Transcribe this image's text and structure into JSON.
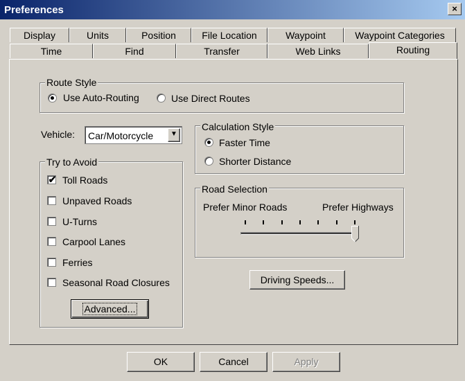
{
  "window": {
    "title": "Preferences",
    "close_glyph": "×"
  },
  "tabs": {
    "row1": [
      "Display",
      "Units",
      "Position",
      "File Location",
      "Waypoint",
      "Waypoint Categories"
    ],
    "row2": [
      "Time",
      "Find",
      "Transfer",
      "Web Links",
      "Routing"
    ],
    "active": "Routing"
  },
  "route_style": {
    "label": "Route Style",
    "options": [
      "Use Auto-Routing",
      "Use Direct Routes"
    ],
    "selected": "Use Auto-Routing"
  },
  "vehicle": {
    "label": "Vehicle:",
    "value": "Car/Motorcycle"
  },
  "calculation_style": {
    "label": "Calculation Style",
    "options": [
      "Faster Time",
      "Shorter Distance"
    ],
    "selected": "Faster Time"
  },
  "avoid": {
    "label": "Try to Avoid",
    "items": [
      {
        "label": "Toll Roads",
        "checked": true
      },
      {
        "label": "Unpaved Roads",
        "checked": false
      },
      {
        "label": "U-Turns",
        "checked": false
      },
      {
        "label": "Carpool Lanes",
        "checked": false
      },
      {
        "label": "Ferries",
        "checked": false
      },
      {
        "label": "Seasonal Road Closures",
        "checked": false
      }
    ],
    "advanced_label": "Advanced..."
  },
  "road_selection": {
    "label": "Road Selection",
    "min_label": "Prefer Minor Roads",
    "max_label": "Prefer Highways",
    "level_fraction": 1.0,
    "tick_count": 7
  },
  "driving_speeds_label": "Driving Speeds...",
  "footer": {
    "ok": "OK",
    "cancel": "Cancel",
    "apply": "Apply"
  }
}
